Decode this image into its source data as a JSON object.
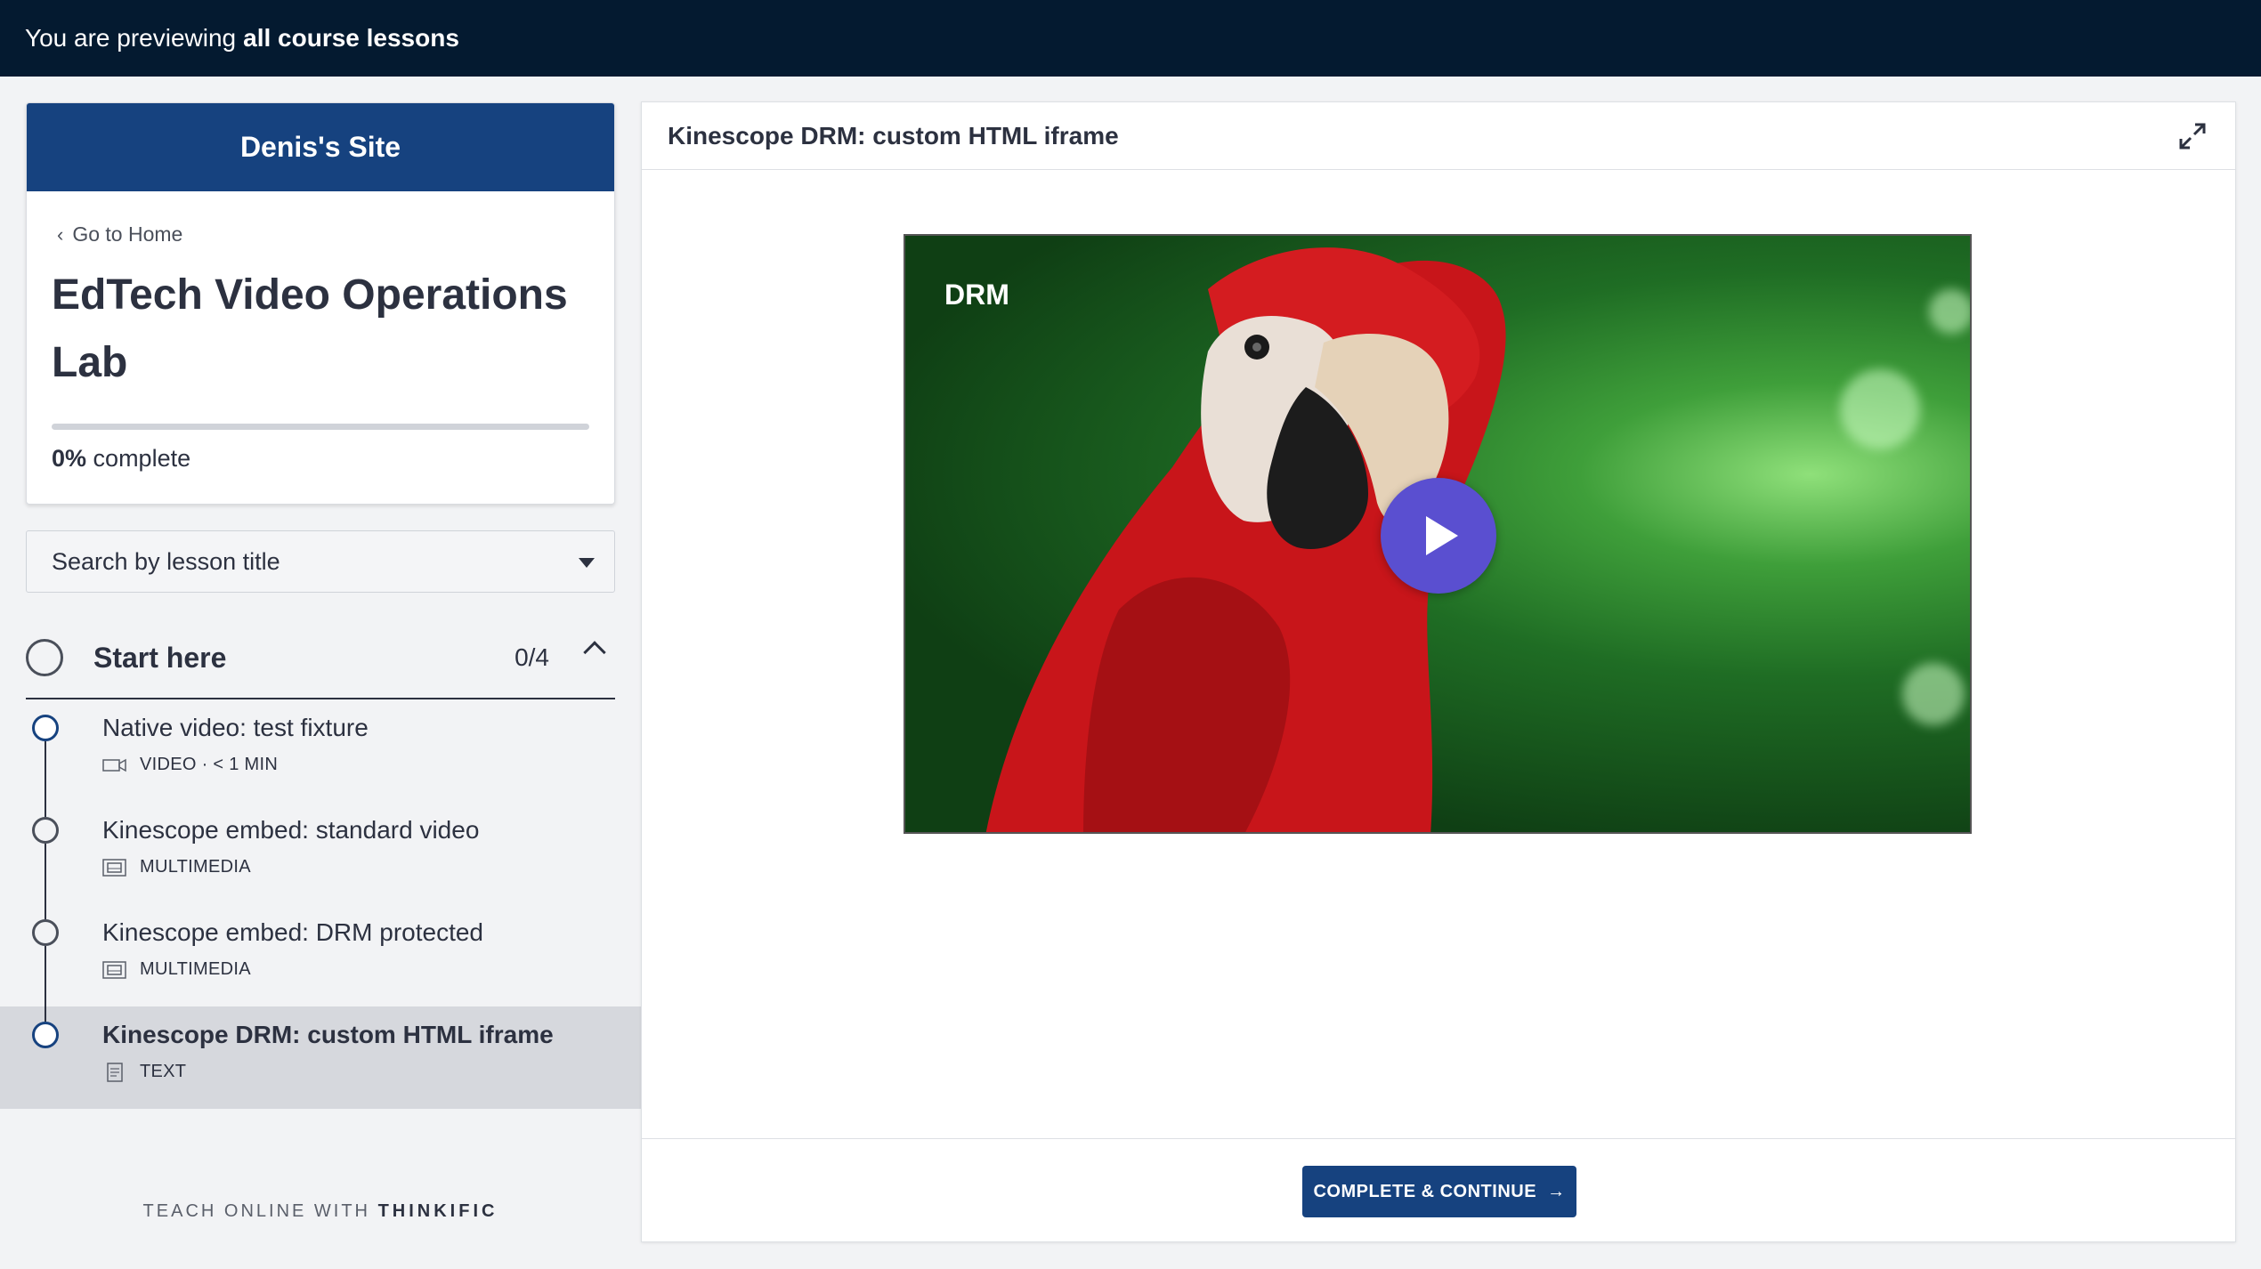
{
  "banner": {
    "prefix": "You are previewing",
    "bold": "all course lessons"
  },
  "sidebar": {
    "site_name": "Denis's Site",
    "back_link": "Go to Home",
    "course_title": "EdTech Video Operations Lab",
    "progress": {
      "percent": 0,
      "percent_label": "0%",
      "suffix": "complete"
    },
    "search": {
      "placeholder": "Search by lesson title"
    },
    "chapter": {
      "title": "Start here",
      "count": "0/4"
    },
    "lessons": [
      {
        "title": "Native video: test fixture",
        "meta": "VIDEO · < 1 MIN",
        "icon": "video-camera-icon"
      },
      {
        "title": "Kinescope embed: standard video",
        "meta": "MULTIMEDIA",
        "icon": "multimedia-icon"
      },
      {
        "title": "Kinescope embed: DRM protected",
        "meta": "MULTIMEDIA",
        "icon": "multimedia-icon"
      },
      {
        "title": "Kinescope DRM: custom HTML iframe",
        "meta": "TEXT",
        "icon": "text-doc-icon"
      }
    ],
    "footer": {
      "prefix": "TEACH ONLINE WITH",
      "brand": "THINKIFIC"
    }
  },
  "main": {
    "lesson_title": "Kinescope DRM: custom HTML iframe",
    "video": {
      "overlay_label": "DRM"
    },
    "complete_button": "COMPLETE & CONTINUE"
  },
  "colors": {
    "banner_bg": "#041a30",
    "brand_blue": "#16427f",
    "play_button": "#5a4fd0",
    "active_lesson_bg": "#d6d8dd"
  }
}
